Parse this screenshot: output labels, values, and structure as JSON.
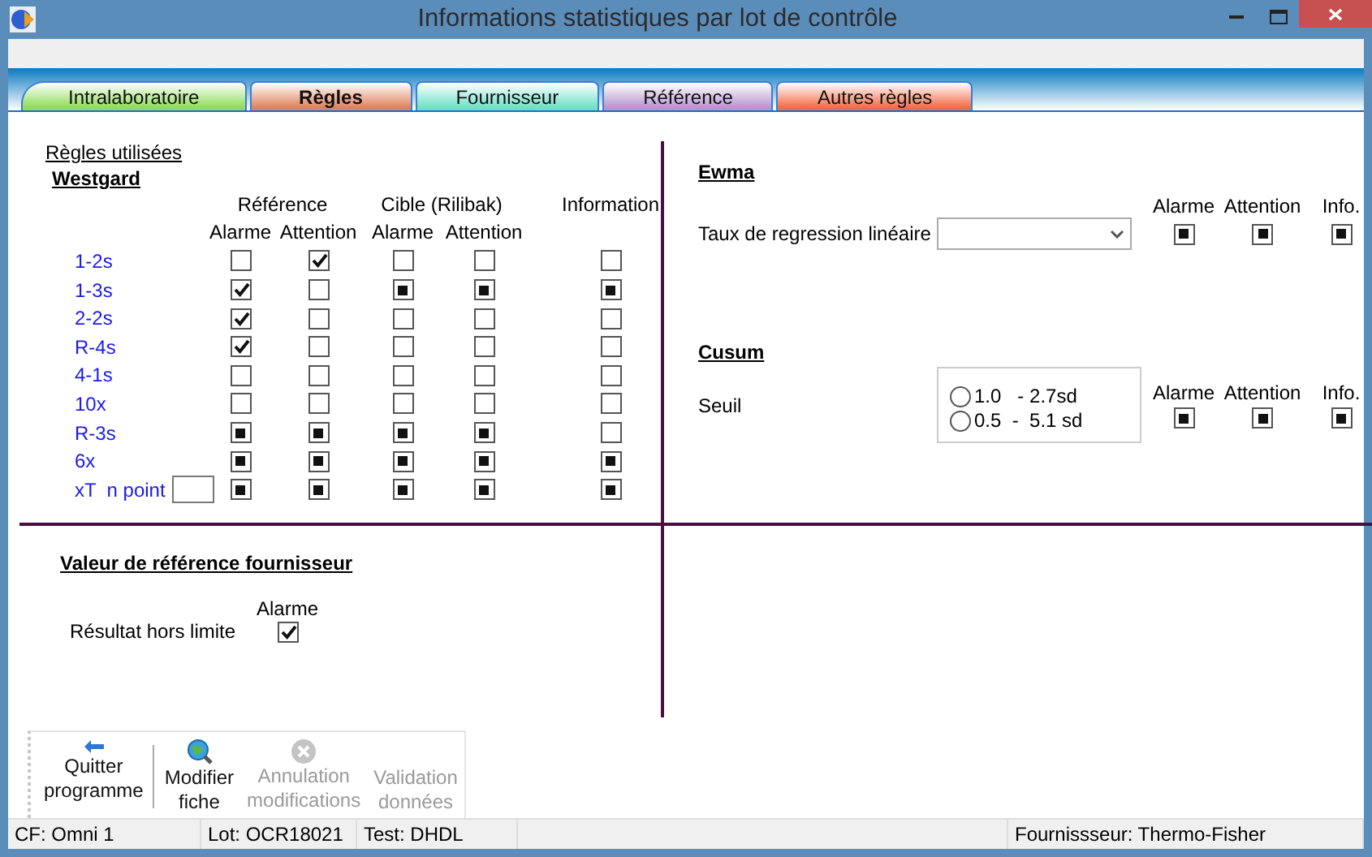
{
  "window": {
    "title": "Informations statistiques par lot de contrôle"
  },
  "tabs": [
    {
      "label": "Intralaboratoire",
      "selected": false,
      "color": "#8fdc5a"
    },
    {
      "label": "Règles",
      "selected": true,
      "color": "#e0825c"
    },
    {
      "label": "Fournisseur",
      "selected": false,
      "color": "#6fe0c8"
    },
    {
      "label": "Référence",
      "selected": false,
      "color": "#b894d0"
    },
    {
      "label": "Autres règles",
      "selected": false,
      "color": "#f46a48"
    }
  ],
  "rules_link": "Règles utilisées",
  "westgard": {
    "title": "Westgard",
    "groups": [
      {
        "label": "Référence",
        "columns": [
          "Alarme",
          "Attention"
        ]
      },
      {
        "label": "Cible (Rilibak)",
        "columns": [
          "Alarme",
          "Attention"
        ]
      },
      {
        "label": "Information"
      }
    ],
    "rows": [
      {
        "label": "1-2s",
        "kind": "plain",
        "cells": [
          {
            "checked": false,
            "indeterminate": false
          },
          {
            "checked": true,
            "indeterminate": false
          },
          {
            "checked": false,
            "indeterminate": false
          },
          {
            "checked": false,
            "indeterminate": false
          },
          {
            "checked": false,
            "indeterminate": false
          }
        ]
      },
      {
        "label": "1-3s",
        "kind": "plain",
        "cells": [
          {
            "checked": true,
            "indeterminate": false
          },
          {
            "checked": false,
            "indeterminate": false
          },
          {
            "checked": true,
            "indeterminate": true
          },
          {
            "checked": true,
            "indeterminate": true
          },
          {
            "checked": true,
            "indeterminate": true
          }
        ]
      },
      {
        "label": "2-2s",
        "kind": "plain",
        "cells": [
          {
            "checked": true,
            "indeterminate": false
          },
          {
            "checked": false,
            "indeterminate": false
          },
          {
            "checked": false,
            "indeterminate": false
          },
          {
            "checked": false,
            "indeterminate": false
          },
          {
            "checked": false,
            "indeterminate": false
          }
        ]
      },
      {
        "label": "R-4s",
        "kind": "plain",
        "cells": [
          {
            "checked": true,
            "indeterminate": false
          },
          {
            "checked": false,
            "indeterminate": false
          },
          {
            "checked": false,
            "indeterminate": false
          },
          {
            "checked": false,
            "indeterminate": false
          },
          {
            "checked": false,
            "indeterminate": false
          }
        ]
      },
      {
        "label": "4-1s",
        "kind": "plain",
        "cells": [
          {
            "checked": false,
            "indeterminate": false
          },
          {
            "checked": false,
            "indeterminate": false
          },
          {
            "checked": false,
            "indeterminate": false
          },
          {
            "checked": false,
            "indeterminate": false
          },
          {
            "checked": false,
            "indeterminate": false
          }
        ]
      },
      {
        "label": "10x",
        "kind": "plain",
        "cells": [
          {
            "checked": false,
            "indeterminate": false
          },
          {
            "checked": false,
            "indeterminate": false
          },
          {
            "checked": false,
            "indeterminate": false
          },
          {
            "checked": false,
            "indeterminate": false
          },
          {
            "checked": false,
            "indeterminate": false
          }
        ]
      },
      {
        "label": "R-3s",
        "kind": "plain",
        "cells": [
          {
            "checked": true,
            "indeterminate": true
          },
          {
            "checked": true,
            "indeterminate": true
          },
          {
            "checked": true,
            "indeterminate": true
          },
          {
            "checked": true,
            "indeterminate": true
          },
          {
            "checked": false,
            "indeterminate": false
          }
        ]
      },
      {
        "label": "6x",
        "kind": "plain",
        "cells": [
          {
            "checked": true,
            "indeterminate": true
          },
          {
            "checked": true,
            "indeterminate": true
          },
          {
            "checked": true,
            "indeterminate": true
          },
          {
            "checked": true,
            "indeterminate": true
          },
          {
            "checked": true,
            "indeterminate": true
          }
        ]
      },
      {
        "label": "xT  n point",
        "kind": "with_field",
        "cells": [
          {
            "checked": true,
            "indeterminate": true
          },
          {
            "checked": true,
            "indeterminate": true
          },
          {
            "checked": true,
            "indeterminate": true
          },
          {
            "checked": true,
            "indeterminate": true
          },
          {
            "checked": true,
            "indeterminate": true
          }
        ]
      }
    ]
  },
  "ewma": {
    "title": "Ewma",
    "label": "Taux de regression linéaire",
    "headers": [
      "Alarme",
      "Attention",
      "Info."
    ],
    "checks": [
      {
        "checked": true,
        "indeterminate": true
      },
      {
        "checked": true,
        "indeterminate": true
      },
      {
        "checked": true,
        "indeterminate": true
      }
    ]
  },
  "cusum": {
    "title": "Cusum",
    "label": "Seuil",
    "radios": [
      {
        "label": "1.0   - 2.7sd",
        "selected": false
      },
      {
        "label": "0.5  -  5.1 sd",
        "selected": false
      }
    ],
    "headers": [
      "Alarme",
      "Attention",
      "Info."
    ],
    "checks": [
      {
        "checked": true,
        "indeterminate": true
      },
      {
        "checked": true,
        "indeterminate": true
      },
      {
        "checked": true,
        "indeterminate": true
      }
    ]
  },
  "supplier": {
    "title": "Valeur de référence fournisseur",
    "header": "Alarme",
    "label": "Résultat hors limite",
    "check": {
      "checked": true,
      "indeterminate": false
    }
  },
  "toolbar": [
    {
      "kind": "exit",
      "lines": [
        "Quitter",
        "programme"
      ],
      "disabled": false
    },
    {
      "kind": "edit",
      "lines": [
        "Modifier",
        "fiche"
      ],
      "disabled": false
    },
    {
      "kind": "cancel",
      "lines": [
        "Annulation",
        "modifications"
      ],
      "disabled": true
    },
    {
      "kind": "validate",
      "lines": [
        "Validation",
        "données"
      ],
      "disabled": true
    }
  ],
  "status_bar": {
    "left": [
      "CF: Omni 1",
      "Lot: OCR18021",
      "Test: DHDL"
    ],
    "right": [
      "Fournissseur: Thermo-Fisher"
    ]
  }
}
